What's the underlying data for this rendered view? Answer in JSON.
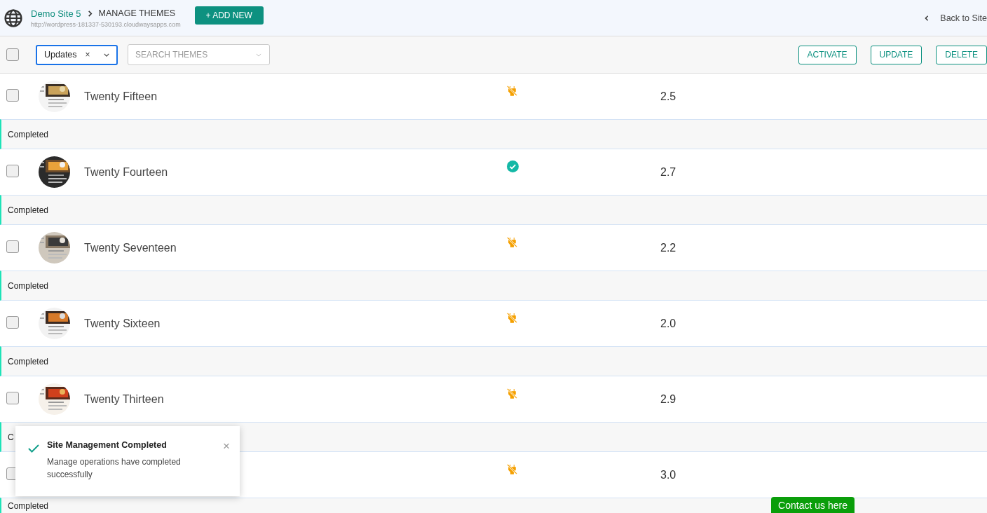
{
  "header": {
    "site": "Demo Site 5",
    "page_title": "MANAGE THEMES",
    "url": "http://wordpress-181337-530193.cloudwaysapps.com",
    "add_button": "+ ADD NEW",
    "back_link": "Back to Site"
  },
  "toolbar": {
    "select_all_checked": false,
    "filter": {
      "value": "Updates",
      "clear": "×"
    },
    "search": {
      "placeholder": "SEARCH THEMES"
    },
    "actions": [
      "ACTIVATE",
      "UPDATE",
      "DELETE"
    ]
  },
  "themes": [
    {
      "name": "Twenty Fifteen",
      "checked": false,
      "active": false,
      "version": "2.5",
      "status": "Completed"
    },
    {
      "name": "Twenty Fourteen",
      "checked": false,
      "active": true,
      "version": "2.7",
      "status": "Completed"
    },
    {
      "name": "Twenty Seventeen",
      "checked": false,
      "active": false,
      "version": "2.2",
      "status": "Completed"
    },
    {
      "name": "Twenty Sixteen",
      "checked": false,
      "active": false,
      "version": "2.0",
      "status": "Completed"
    },
    {
      "name": "Twenty Thirteen",
      "checked": false,
      "active": false,
      "version": "2.9",
      "status": "C"
    },
    {
      "checked": false,
      "active": false,
      "version": "3.0",
      "status": "Completed"
    }
  ],
  "toast": {
    "title": "Site Management Completed",
    "message": "Manage operations have completed successfully",
    "close": "×"
  },
  "contact_button": "Contact us here"
}
